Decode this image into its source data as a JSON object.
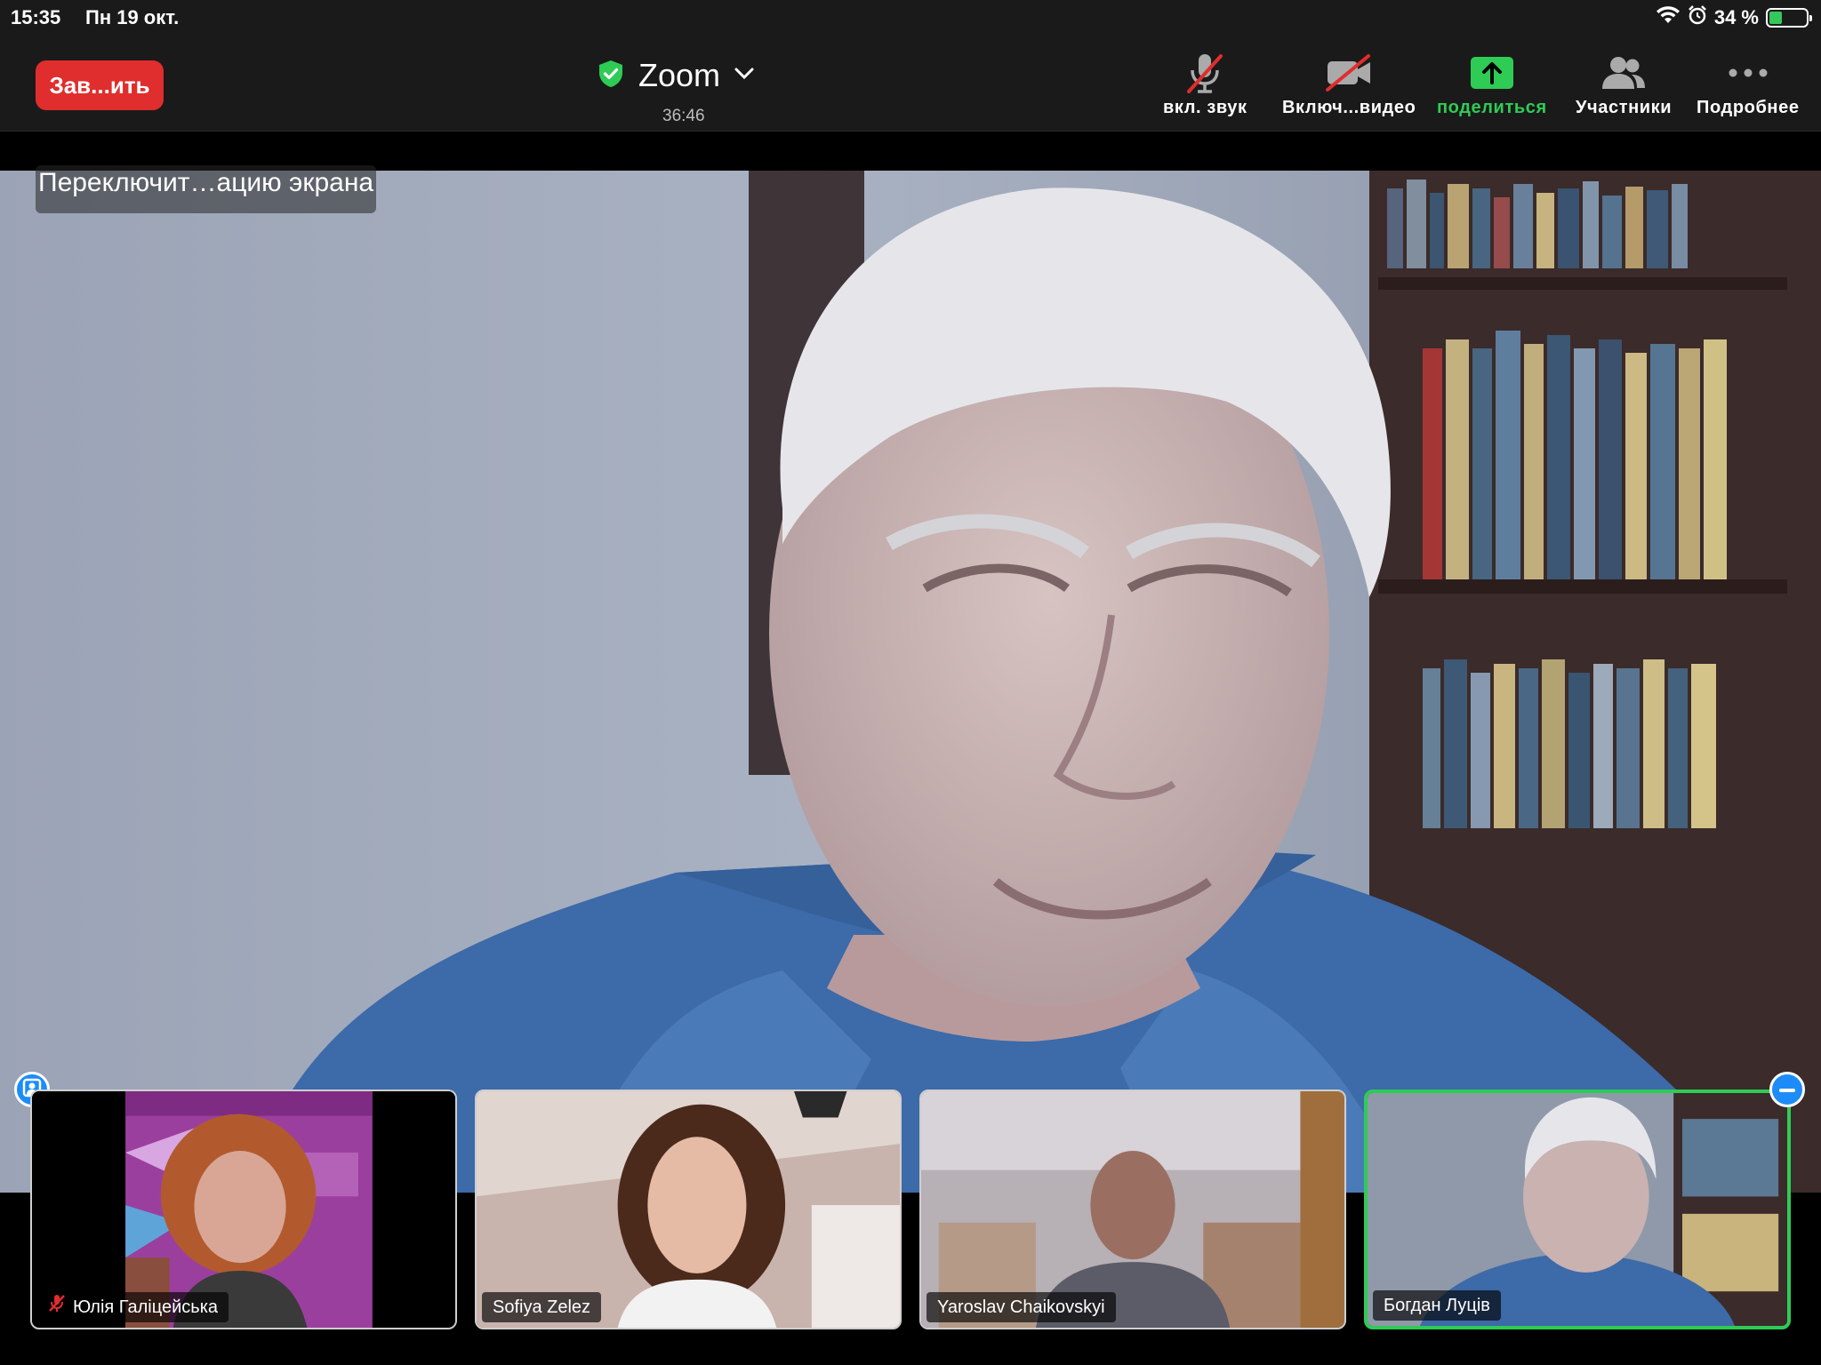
{
  "status_bar": {
    "time": "15:35",
    "date": "Пн 19 окт.",
    "battery": "34 %",
    "battery_level": 0.34
  },
  "toolbar": {
    "end_label": "Зав...ить",
    "title": "Zoom",
    "timer": "36:46",
    "mute_label": "вкл. звук",
    "video_label": "Включ...видео",
    "share_label": "поделиться",
    "participants_label": "Участники",
    "more_label": "Подробнее"
  },
  "main": {
    "switch_label": "Переключит…ацию экрана"
  },
  "participants": [
    {
      "name": "Юлія Галіцейська",
      "muted": true
    },
    {
      "name": "Sofiya Zelez",
      "muted": false
    },
    {
      "name": "Yaroslav Chaikovskyi",
      "muted": false
    },
    {
      "name": "Богдан Луців",
      "muted": false,
      "active": true
    }
  ],
  "colors": {
    "end_button": "#e02d2d",
    "share_green": "#2ecc55",
    "accent_blue": "#1d8cf8",
    "toolbar_bg": "#1a1a1a"
  }
}
